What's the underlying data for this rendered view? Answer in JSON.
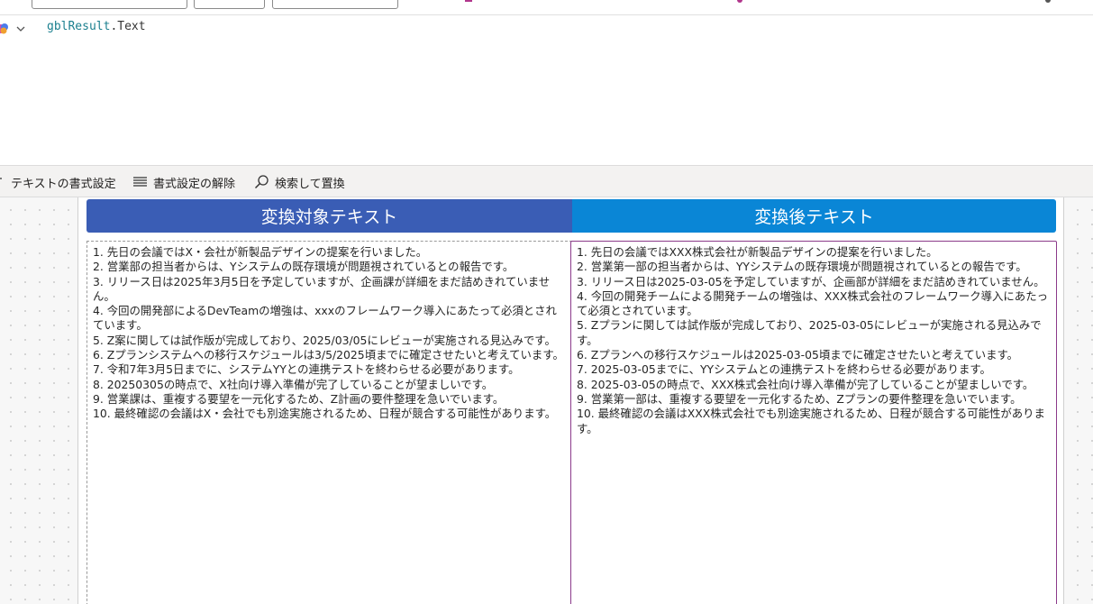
{
  "formula_bar": {
    "object": "gblResult",
    "dot": ".",
    "property": "Text"
  },
  "toolbar": {
    "format_text_label": "テキストの書式設定",
    "clear_format_label": "書式設定の解除",
    "find_replace_label": "検索して置換"
  },
  "screen": {
    "source_header": "変換対象テキスト",
    "result_header": "変換後テキスト",
    "source_lines": [
      "1. 先日の会議ではX・会社が新製品デザインの提案を行いました。",
      "2. 営業部の担当者からは、Yシステムの既存環境が問題視されているとの報告です。",
      "3. リリース日は2025年3月5日を予定していますが、企画課が詳細をまだ詰めきれていません。",
      "4. 今回の開発部によるDevTeamの増強は、xxxのフレームワーク導入にあたって必須とされています。",
      "5. Z案に関しては試作版が完成しており、2025/03/05にレビューが実施される見込みです。",
      "6. Zプランシステムへの移行スケジュールは3/5/2025頃までに確定させたいと考えています。",
      "7. 令和7年3月5日までに、システムYYとの連携テストを終わらせる必要があります。",
      "8. 20250305の時点で、X社向け導入準備が完了していることが望ましいです。",
      "9. 営業課は、重複する要望を一元化するため、Z計画の要件整理を急いでいます。",
      "10. 最終確認の会議はX・会社でも別途実施されるため、日程が競合する可能性があります。"
    ],
    "result_lines": [
      "1. 先日の会議ではXXX株式会社が新製品デザインの提案を行いました。",
      "2. 営業第一部の担当者からは、YYシステムの既存環境が問題視されているとの報告です。",
      "3. リリース日は2025-03-05を予定していますが、企画部が詳細をまだ詰めきれていません。",
      "4. 今回の開発チームによる開発チームの増強は、XXX株式会社のフレームワーク導入にあたって必須とされています。",
      "5. Zプランに関しては試作版が完成しており、2025-03-05にレビューが実施される見込みです。",
      "6. Zプランへの移行スケジュールは2025-03-05頃までに確定させたいと考えています。",
      "7. 2025-03-05までに、YYシステムとの連携テストを終わらせる必要があります。",
      "8. 2025-03-05の時点で、XXX株式会社向け導入準備が完了していることが望ましいです。",
      "9. 営業第一部は、重複する要望を一元化するため、Zプランの要件整理を急いでいます。",
      "10. 最終確認の会議はXXX株式会社でも別途実施されるため、日程が競合する可能性があります。"
    ]
  },
  "colors": {
    "source_header_bg": "#3a5db5",
    "result_header_bg": "#0a86d6",
    "selection_border": "#8b3a8a",
    "formula_object": "#1a7f8e"
  },
  "icons": {
    "copilot": "copilot-icon",
    "chevron": "chevron-down-icon",
    "format_text": "format-text-icon",
    "clear_format": "clear-format-icon",
    "find_replace": "search-icon"
  }
}
